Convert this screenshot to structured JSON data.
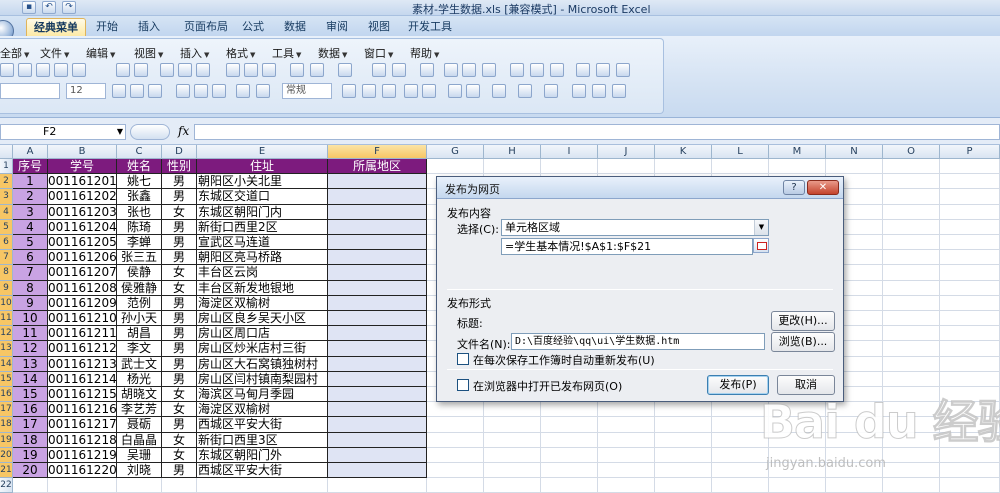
{
  "window": {
    "title": "素材-学生数据.xls  [兼容模式] - Microsoft Excel"
  },
  "ribbon_tabs": [
    "经典菜单",
    "开始",
    "插入",
    "页面布局",
    "公式",
    "数据",
    "审阅",
    "视图",
    "开发工具"
  ],
  "classic_menu": [
    "全部",
    "文件",
    "编辑",
    "视图",
    "插入",
    "格式",
    "工具",
    "数据",
    "窗口",
    "帮助"
  ],
  "font_size": "12",
  "style_combo": "常规",
  "name_box": "F2",
  "columns": [
    "A",
    "B",
    "C",
    "D",
    "E",
    "F",
    "G",
    "H",
    "I",
    "J",
    "K",
    "L",
    "M",
    "N",
    "O",
    "P"
  ],
  "row_numbers": [
    "1",
    "2",
    "3",
    "4",
    "5",
    "6",
    "7",
    "8",
    "9",
    "10",
    "11",
    "12",
    "13",
    "14",
    "15",
    "16",
    "17",
    "18",
    "19",
    "20",
    "21",
    "22"
  ],
  "table": {
    "headers": [
      "序号",
      "学号",
      "姓名",
      "性别",
      "住址",
      "所属地区"
    ],
    "rows": [
      [
        "1",
        "001161201",
        "姚七",
        "男",
        "朝阳区小关北里",
        ""
      ],
      [
        "2",
        "001161202",
        "张鑫",
        "男",
        "东城区交道口",
        ""
      ],
      [
        "3",
        "001161203",
        "张也",
        "女",
        "东城区朝阳门内",
        ""
      ],
      [
        "4",
        "001161204",
        "陈琦",
        "男",
        "新街口西里2区",
        ""
      ],
      [
        "5",
        "001161205",
        "李蝉",
        "男",
        "宣武区马连道",
        ""
      ],
      [
        "6",
        "001161206",
        "张三五",
        "男",
        "朝阳区亮马桥路",
        ""
      ],
      [
        "7",
        "001161207",
        "侯静",
        "女",
        "丰台区云岗",
        ""
      ],
      [
        "8",
        "001161208",
        "侯雅静",
        "女",
        "丰台区新发地银地",
        ""
      ],
      [
        "9",
        "001161209",
        "范例",
        "男",
        "海淀区双榆树",
        ""
      ],
      [
        "10",
        "001161210",
        "孙小天",
        "男",
        "房山区良乡吴天小区",
        ""
      ],
      [
        "11",
        "001161211",
        "胡昌",
        "男",
        "房山区周口店",
        ""
      ],
      [
        "12",
        "001161212",
        "李文",
        "男",
        "房山区炒米店村三街",
        ""
      ],
      [
        "13",
        "001161213",
        "武士文",
        "男",
        "房山区大石窝镇独树村",
        ""
      ],
      [
        "14",
        "001161214",
        "杨光",
        "男",
        "房山区闫村镇南梨园村",
        ""
      ],
      [
        "15",
        "001161215",
        "胡晓文",
        "女",
        "海滨区马甸月季园",
        ""
      ],
      [
        "16",
        "001161216",
        "李艺芳",
        "女",
        "海淀区双榆树",
        ""
      ],
      [
        "17",
        "001161217",
        "聂砺",
        "男",
        "西城区平安大街",
        ""
      ],
      [
        "18",
        "001161218",
        "白晶晶",
        "女",
        "新街口西里3区",
        ""
      ],
      [
        "19",
        "001161219",
        "吴珊",
        "女",
        "东城区朝阳门外",
        ""
      ],
      [
        "20",
        "001161220",
        "刘晓",
        "男",
        "西城区平安大街",
        ""
      ]
    ]
  },
  "dialog": {
    "title": "发布为网页",
    "help_btn": "?",
    "close_btn": "✕",
    "group_content": "发布内容",
    "select_label": "选择(C):",
    "select_value": "单元格区域",
    "range_value": "=学生基本情况!$A$1:$F$21",
    "group_format": "发布形式",
    "title_label": "标题:",
    "change_btn": "更改(H)...",
    "filename_label": "文件名(N):",
    "filename_value": "D:\\百度经验\\qq\\ui\\学生数据.htm",
    "browse_btn": "浏览(B)...",
    "auto_republish": "在每次保存工作簿时自动重新发布(U)",
    "open_in_browser": "在浏览器中打开已发布网页(O)",
    "publish_btn": "发布(P)",
    "cancel_btn": "取消"
  },
  "watermark": {
    "logo": "Bai du 经验",
    "url": "jingyan.baidu.com"
  },
  "colors": {
    "header_fill": "#7d1b7e",
    "col_a_fill": "#c9a3e3",
    "col_f_fill": "#dfe4f4",
    "ribbon_blue": "#c2d6ef"
  }
}
